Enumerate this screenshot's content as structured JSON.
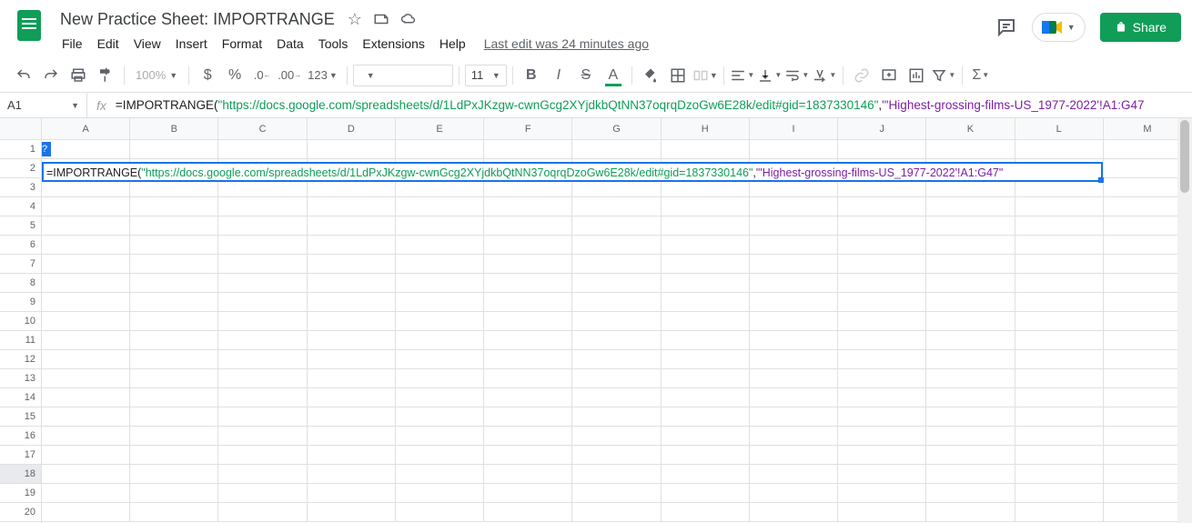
{
  "header": {
    "title": "New Practice Sheet: IMPORTRANGE",
    "last_edit": "Last edit was 24 minutes ago",
    "share_label": "Share"
  },
  "menu": {
    "file": "File",
    "edit": "Edit",
    "view": "View",
    "insert": "Insert",
    "format": "Format",
    "data": "Data",
    "tools": "Tools",
    "extensions": "Extensions",
    "help": "Help"
  },
  "toolbar": {
    "zoom": "100%",
    "number_format": "123",
    "font_size": "11"
  },
  "name_box": "A1",
  "formula": {
    "prefix": "=IMPORTRANGE(",
    "url": "\"https://docs.google.com/spreadsheets/d/1LdPxJKzgw-cwnGcg2XYjdkbQtNN37oqrqDzoGw6E28k/edit#gid=1837330146\"",
    "sep": ",",
    "range_prefix_quote": "\"",
    "range": "'Highest-grossing-films-US_1977-2022'!A1:G47",
    "range_suffix_quote": "\""
  },
  "cell_formula": {
    "prefix": "=IMPORTRANGE(",
    "url": "\"https://docs.google.com/spreadsheets/d/1LdPxJKzgw-cwnGcg2XYjdkbQtNN37oqrqDzoGw6E28k/edit#gid=1837330146\"",
    "sep": ",",
    "range": "\"'Highest-grossing-films-US_1977-2022'!A1:G47\""
  },
  "help_badge": "?",
  "columns": [
    "A",
    "B",
    "C",
    "D",
    "E",
    "F",
    "G",
    "H",
    "I",
    "J",
    "K",
    "L",
    "M"
  ],
  "rows": [
    "1",
    "2",
    "3",
    "4",
    "5",
    "6",
    "7",
    "8",
    "9",
    "10",
    "11",
    "12",
    "13",
    "14",
    "15",
    "16",
    "17",
    "18",
    "19",
    "20"
  ]
}
